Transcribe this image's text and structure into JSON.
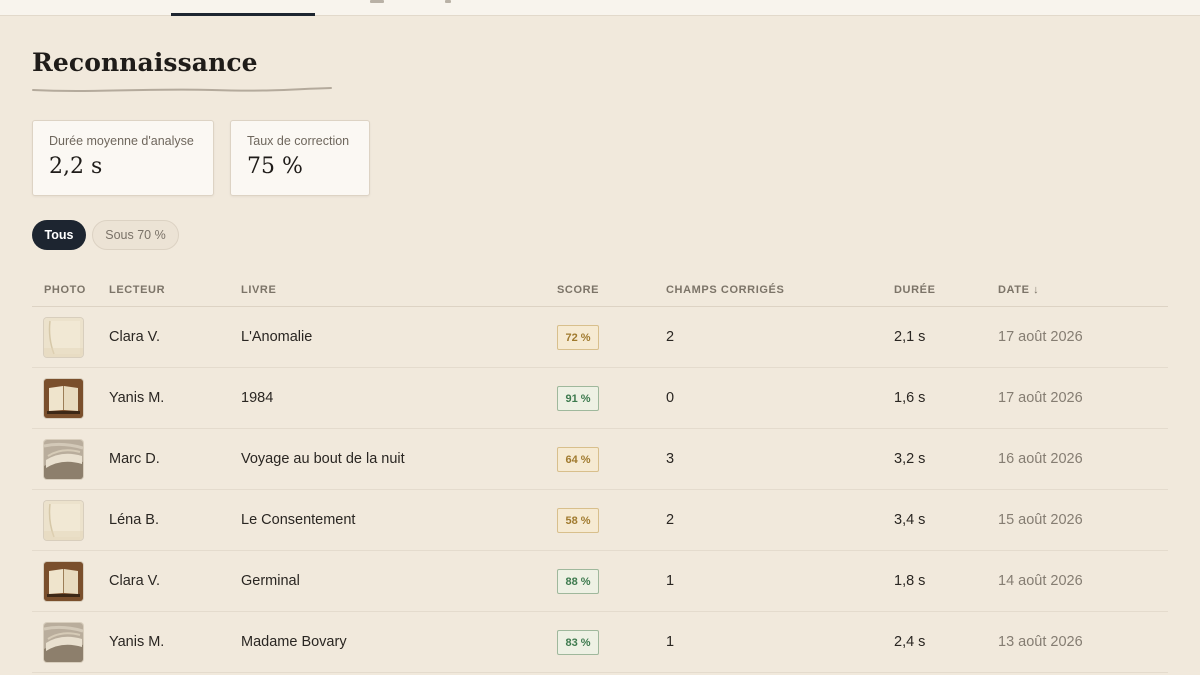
{
  "colors": {
    "accent_dark": "#1d2530",
    "score_good_text": "#3d7a4e",
    "score_good_bg": "#eef1e4",
    "score_good_border": "#9fb89c",
    "score_low_text": "#a07a2e",
    "score_low_bg": "#f6ead2",
    "score_low_border": "#d8bf8c"
  },
  "page": {
    "title": "Reconnaissance"
  },
  "stats": [
    {
      "label": "Durée moyenne d'analyse",
      "value": "2,2 s"
    },
    {
      "label": "Taux de correction",
      "value": "75 %"
    }
  ],
  "filters": [
    {
      "label": "Tous",
      "active": true
    },
    {
      "label": "Sous 70 %",
      "active": false
    }
  ],
  "table": {
    "headers": {
      "photo": "PHOTO",
      "reader": "LECTEUR",
      "book": "LIVRE",
      "score": "SCORE",
      "fields": "CHAMPS CORRIGÉS",
      "duration": "DURÉE",
      "date": "DATE ↓"
    },
    "rows": [
      {
        "photo": "blank-page-photo",
        "reader": "Clara V.",
        "book": "L'Anomalie",
        "score": "72 %",
        "score_level": "low",
        "fields": "2",
        "duration": "2,1 s",
        "date": "17 août 2026"
      },
      {
        "photo": "open-book-photo",
        "reader": "Yanis M.",
        "book": "1984",
        "score": "91 %",
        "score_level": "good",
        "fields": "0",
        "duration": "1,6 s",
        "date": "17 août 2026"
      },
      {
        "photo": "book-pages-photo",
        "reader": "Marc D.",
        "book": "Voyage au bout de la nuit",
        "score": "64 %",
        "score_level": "low",
        "fields": "3",
        "duration": "3,2 s",
        "date": "16 août 2026"
      },
      {
        "photo": "blank-page-photo",
        "reader": "Léna B.",
        "book": "Le Consentement",
        "score": "58 %",
        "score_level": "low",
        "fields": "2",
        "duration": "3,4 s",
        "date": "15 août 2026"
      },
      {
        "photo": "open-book-photo",
        "reader": "Clara V.",
        "book": "Germinal",
        "score": "88 %",
        "score_level": "good",
        "fields": "1",
        "duration": "1,8 s",
        "date": "14 août 2026"
      },
      {
        "photo": "book-pages-photo",
        "reader": "Yanis M.",
        "book": "Madame Bovary",
        "score": "83 %",
        "score_level": "good",
        "fields": "1",
        "duration": "2,4 s",
        "date": "13 août 2026"
      }
    ]
  }
}
